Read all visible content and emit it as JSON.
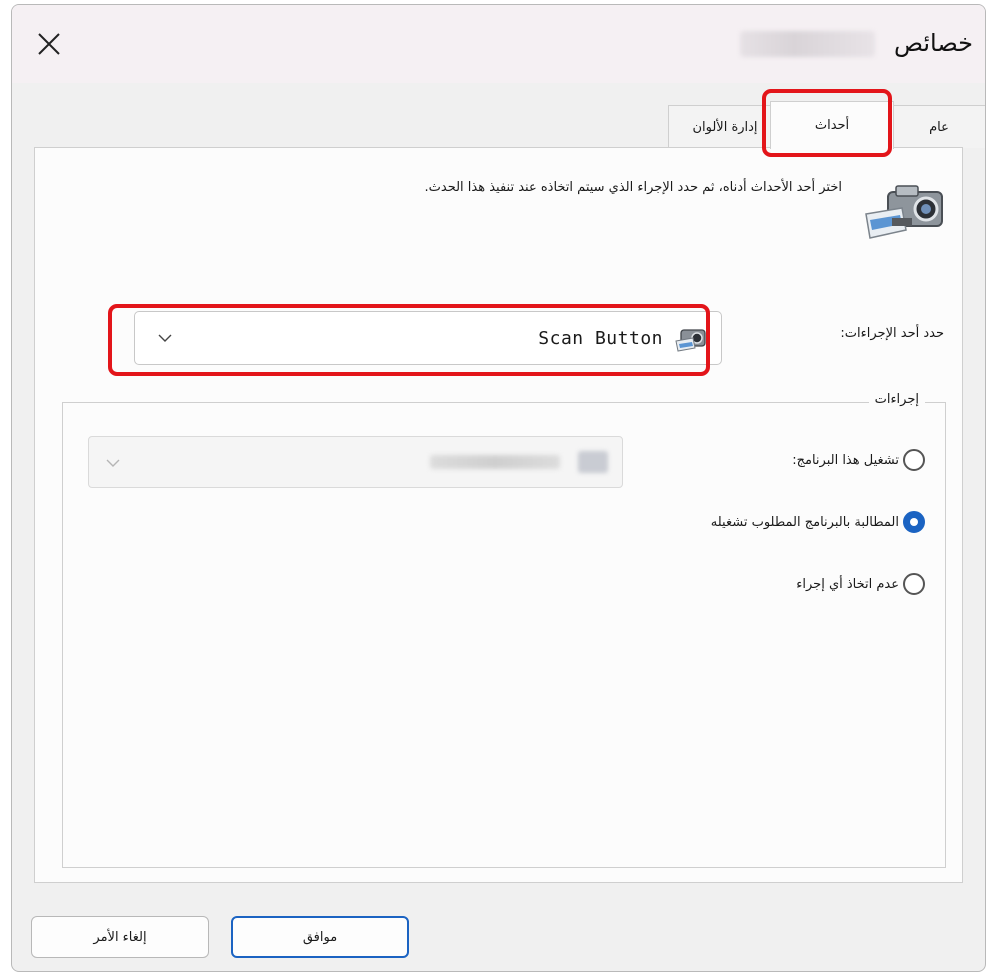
{
  "window": {
    "title": "خصائص",
    "close_icon": "close-icon"
  },
  "tabs": [
    {
      "label": "عام",
      "active": false
    },
    {
      "label": "أحداث",
      "active": true
    },
    {
      "label": "إدارة الألوان",
      "active": false
    }
  ],
  "events": {
    "description": "اختر أحد الأحداث أدناه، ثم حدد الإجراء الذي سيتم اتخاذه عند تنفيذ هذا الحدث.",
    "device_icon": "scanner-camera-icon",
    "select_label": "حدد أحد الإجراءات:",
    "selected_event": "Scan Button",
    "selected_event_icon": "scanner-icon"
  },
  "actions": {
    "group_label": "إجراءات",
    "options": [
      {
        "label": "تشغيل هذا البرنامج:",
        "checked": false
      },
      {
        "label": "المطالبة بالبرنامج المطلوب تشغيله",
        "checked": true
      },
      {
        "label": "عدم اتخاذ أي إجراء",
        "checked": false
      }
    ]
  },
  "buttons": {
    "ok": "موافق",
    "cancel": "إلغاء الأمر"
  },
  "colors": {
    "accent": "#1b63c2",
    "highlight": "#e3151a"
  }
}
